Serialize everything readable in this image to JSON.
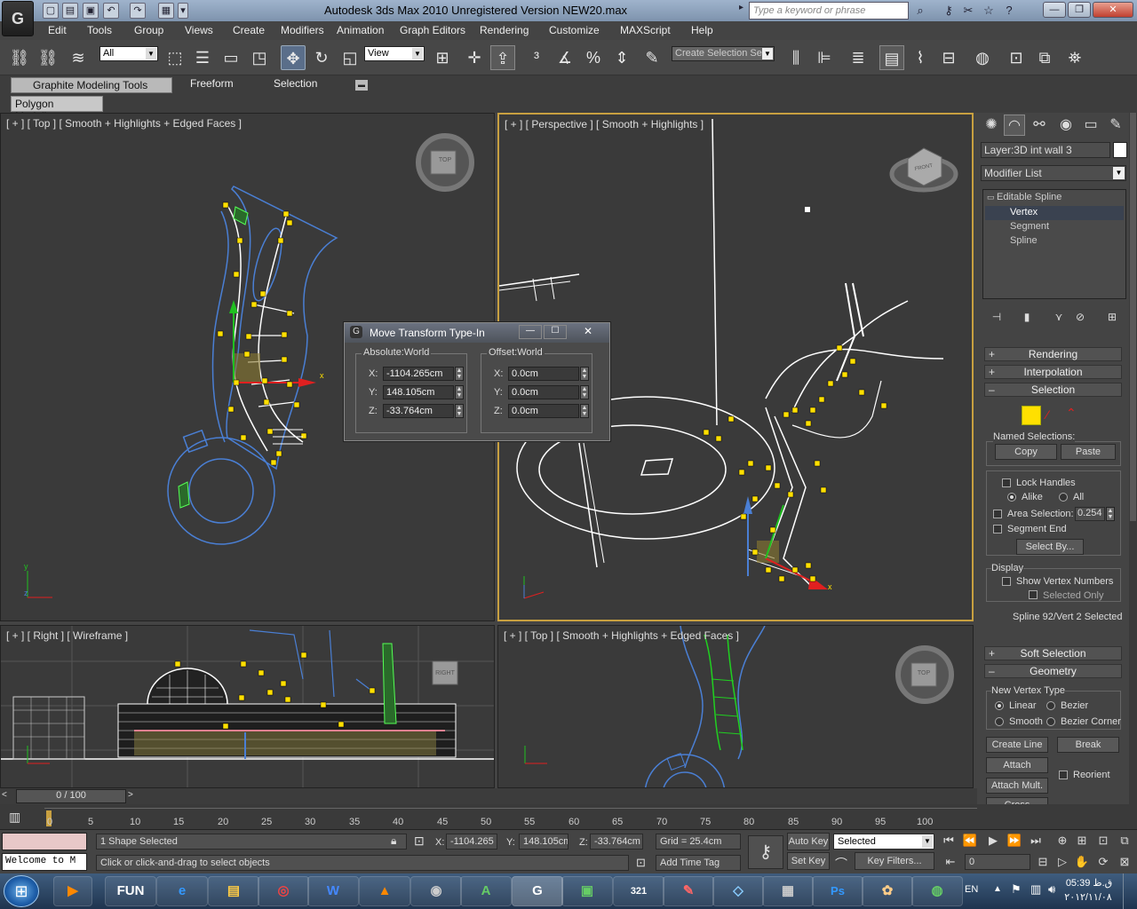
{
  "window": {
    "title": "Autodesk 3ds Max  2010    Unregistered Version       NEW20.max",
    "search_placeholder": "Type a keyword or phrase",
    "logo_letter": "G"
  },
  "menu": [
    "Edit",
    "Tools",
    "Group",
    "Views",
    "Create",
    "Modifiers",
    "Animation",
    "Graph Editors",
    "Rendering",
    "Customize",
    "MAXScript",
    "Help"
  ],
  "toolbar": {
    "filter_select": "All",
    "refcoord_select": "View",
    "named_selection": "Create Selection Se"
  },
  "ribbon": {
    "tabs": [
      "Graphite Modeling Tools",
      "Freeform",
      "Selection"
    ],
    "subtab": "Polygon Modeling"
  },
  "viewports": {
    "top_left": "[ + ] [ Top ] [ Smooth + Highlights + Edged Faces ]",
    "top_right": "[ + ] [ Perspective ] [ Smooth + Highlights ]",
    "bottom_left": "[ + ] [ Right ] [ Wireframe ]",
    "bottom_right": "[ + ] [ Top ] [ Smooth + Highlights + Edged Faces ]",
    "cube_top": "TOP",
    "cube_front": "FRONT",
    "cube_right": "RIGHT",
    "axis_x": "x",
    "axis_y": "y",
    "axis_z": "z"
  },
  "dialog": {
    "title": "Move Transform Type-In",
    "absolute_title": "Absolute:World",
    "offset_title": "Offset:World",
    "labels": [
      "X:",
      "Y:",
      "Z:"
    ],
    "abs_x": "-1104.265cm",
    "abs_y": "148.105cm",
    "abs_z": "-33.764cm",
    "off_x": "0.0cm",
    "off_y": "0.0cm",
    "off_z": "0.0cm"
  },
  "panel": {
    "layer": "Layer:3D int wall 3",
    "modifier_list": "Modifier List",
    "stack": [
      "Editable Spline",
      "Vertex",
      "Segment",
      "Spline"
    ],
    "rollouts": {
      "rendering": "Rendering",
      "interpolation": "Interpolation",
      "selection": "Selection",
      "soft_selection": "Soft Selection",
      "geometry": "Geometry"
    },
    "named_selections": "Named Selections:",
    "copy": "Copy",
    "paste": "Paste",
    "lock_handles": "Lock Handles",
    "alike": "Alike",
    "all": "All",
    "area_selection": "Area Selection:",
    "area_value": "0.254",
    "segment_end": "Segment End",
    "select_by": "Select By...",
    "display": "Display",
    "show_vertex_numbers": "Show Vertex Numbers",
    "selected_only": "Selected Only",
    "selection_status": "Spline 92/Vert 2 Selected",
    "new_vertex_type": "New Vertex Type",
    "linear": "Linear",
    "bezier": "Bezier",
    "smooth": "Smooth",
    "bezier_corner": "Bezier Corner",
    "create_line": "Create Line",
    "break": "Break",
    "attach": "Attach",
    "reorient": "Reorient",
    "attach_mult": "Attach Mult.",
    "cross_section": "Cross Section"
  },
  "timeline": {
    "frame": "0 / 100",
    "ticks": [
      "0",
      "5",
      "10",
      "15",
      "20",
      "25",
      "30",
      "35",
      "40",
      "45",
      "50",
      "55",
      "60",
      "65",
      "70",
      "75",
      "80",
      "85",
      "90",
      "95",
      "100"
    ]
  },
  "status": {
    "shapes_selected": "1 Shape Selected",
    "prompt": "Click or click-and-drag to select objects",
    "script_listener": "Welcome to M",
    "x_label": "X:",
    "x": "-1104.265",
    "y_label": "Y:",
    "y": "148.105cm",
    "z_label": "Z:",
    "z": "-33.764cm",
    "grid": "Grid = 25.4cm",
    "add_time_tag": "Add Time Tag",
    "auto_key": "Auto Key",
    "set_key": "Set Key",
    "selected_select": "Selected",
    "key_filters": "Key Filters...",
    "frame_field": "0"
  },
  "taskbar": {
    "apps": [
      "FUN",
      "e",
      "",
      "",
      "W",
      "",
      "",
      "G",
      "",
      "",
      "321",
      "",
      "",
      "",
      "Ps",
      "",
      ""
    ],
    "lang": "EN",
    "time": "05:39 ق.ظ",
    "date": "۲۰۱۲/۱۱/۰۸"
  },
  "colors": {
    "accent_yellow": "#ffe000",
    "spline_blue": "#4a7fd4",
    "axis_red": "#e02020",
    "axis_green": "#20c020"
  }
}
